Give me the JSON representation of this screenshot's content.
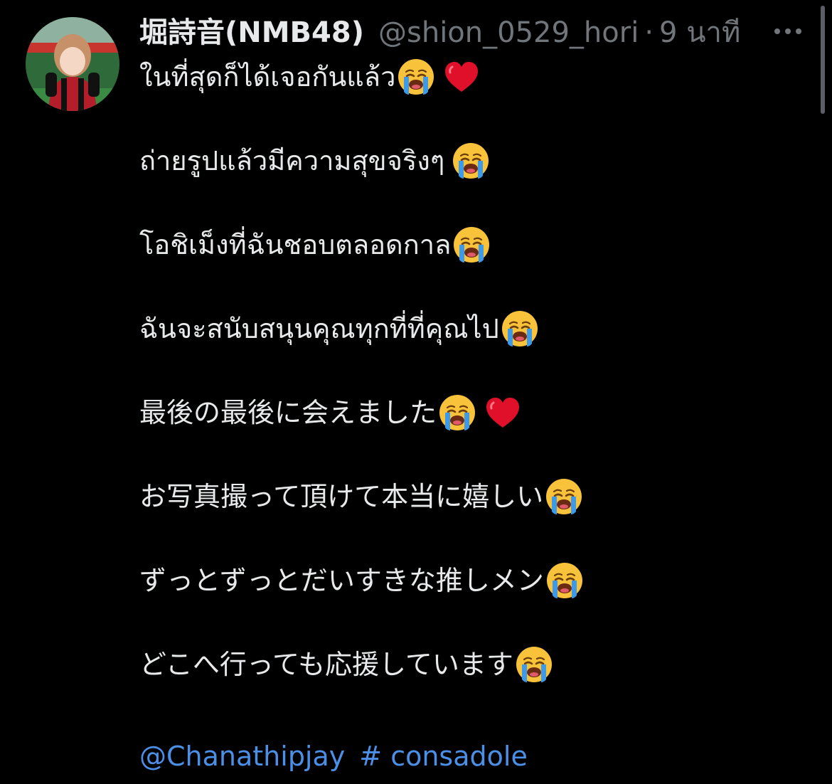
{
  "tweet": {
    "author": {
      "display_name": "堀詩音(NMB48)",
      "handle": "@shion_0529_hori",
      "separator": "·",
      "time": "9 นาที"
    },
    "lines": [
      {
        "text": "ในที่สุดก็ได้เจอกันแล้ว",
        "emojis": [
          "crying-face",
          "red-heart"
        ]
      },
      {
        "text": "ถ่ายรูปแล้วมีความสุขจริงๆ",
        "emojis": [
          "crying-face"
        ],
        "spaced": true
      },
      {
        "text": "โอชิเม็งที่ฉันชอบตลอดกาล",
        "emojis": [
          "crying-face"
        ]
      },
      {
        "text": "ฉันจะสนับสนุนคุณทุกที่ที่คุณไป",
        "emojis": [
          "crying-face"
        ]
      },
      {
        "text": "最後の最後に会えました",
        "emojis": [
          "crying-face",
          "red-heart"
        ]
      },
      {
        "text": "お写真撮って頂けて本当に嬉しい",
        "emojis": [
          "crying-face"
        ]
      },
      {
        "text": "ずっとずっとだいすきな推しメン",
        "emojis": [
          "crying-face"
        ]
      },
      {
        "text": "どこへ行っても応援しています",
        "emojis": [
          "crying-face"
        ]
      }
    ],
    "mention": "@Chanathipjay",
    "hashtag": "# consadole"
  },
  "icons": {
    "more": "more-horizontal-icon",
    "crying": "loudly-crying-face-emoji",
    "heart": "red-heart-emoji"
  },
  "colors": {
    "background": "#000000",
    "text": "#e7e9ea",
    "secondary": "#71767b",
    "link": "#4c8fe6",
    "heart": "#e0102a",
    "emoji_face": "#f8c33a",
    "emoji_tears": "#3c9ae8"
  }
}
